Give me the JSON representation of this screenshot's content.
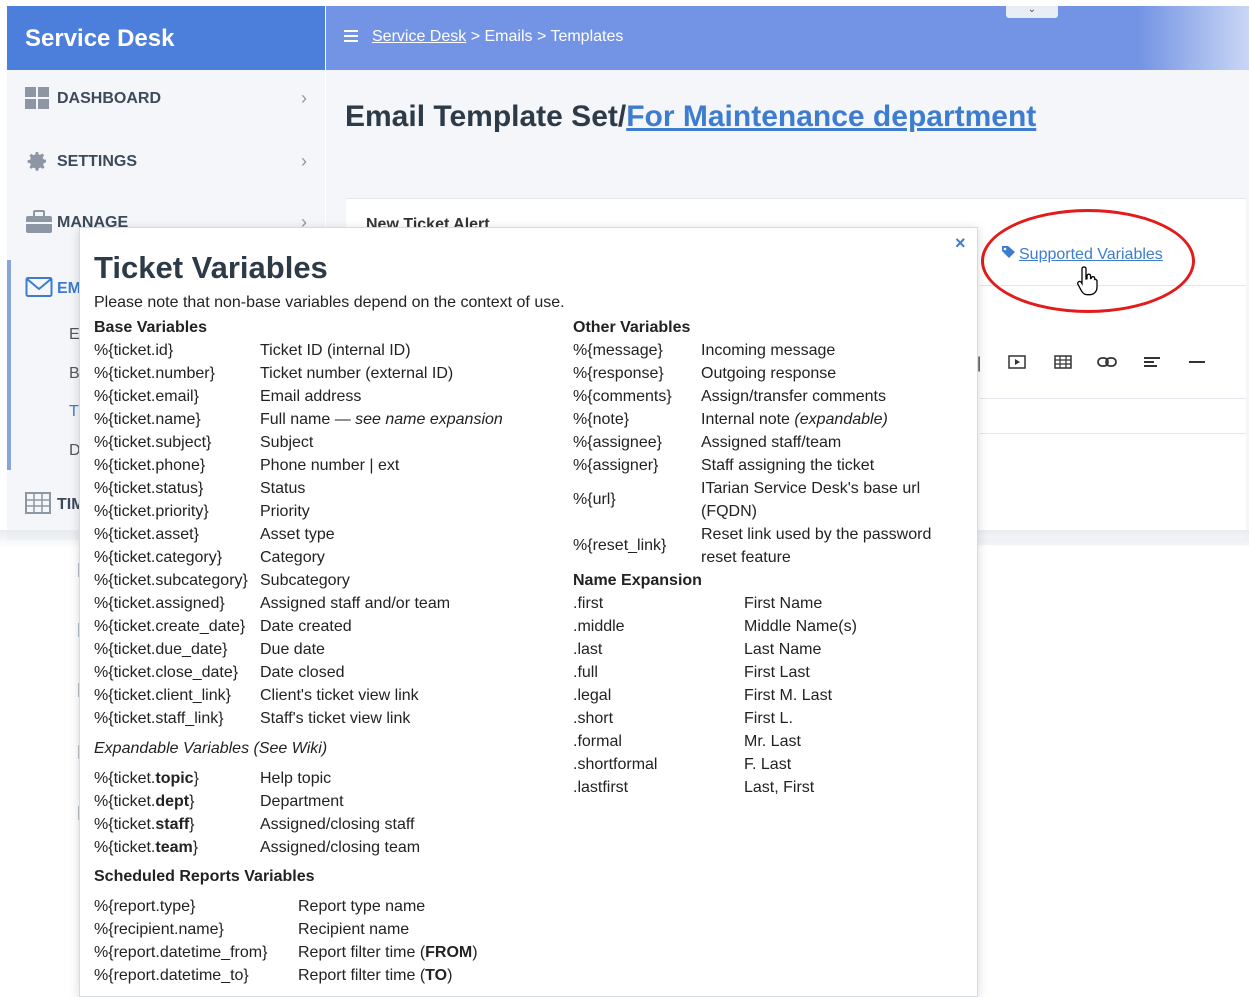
{
  "app": {
    "title": "Service Desk"
  },
  "header": {
    "breadcrumb": {
      "root": "Service Desk",
      "sep1": " > ",
      "level2": "Emails",
      "sep2": " > ",
      "level3": "Templates"
    }
  },
  "sidebar": {
    "items": [
      {
        "label": "DASHBOARD",
        "icon": "dashboard-icon"
      },
      {
        "label": "SETTINGS",
        "icon": "gear-icon"
      },
      {
        "label": "MANAGE",
        "icon": "briefcase-icon"
      },
      {
        "label": "EM",
        "icon": "envelope-icon"
      },
      {
        "label": "TIM",
        "icon": "table-icon"
      }
    ],
    "sub_letters": [
      "E",
      "B",
      "T",
      "D"
    ]
  },
  "main": {
    "title_prefix": "Email Template Set/",
    "title_link": "For Maintenance department",
    "card_title": "New Ticket Alert",
    "supported_variables": "Supported Variables",
    "toolbar_icons": [
      "divider-icon",
      "video-icon",
      "table-icon",
      "link-icon",
      "align-left-icon",
      "horizontal-rule-icon"
    ]
  },
  "popup": {
    "close_glyph": "×",
    "title": "Ticket Variables",
    "note": "Please note that non-base variables depend on the context of use.",
    "base": {
      "heading": "Base Variables",
      "rows": [
        {
          "name": "%{ticket.id}",
          "desc": "Ticket ID (internal ID)"
        },
        {
          "name": "%{ticket.number}",
          "desc": "Ticket number (external ID)"
        },
        {
          "name": "%{ticket.email}",
          "desc": "Email address"
        },
        {
          "name": "%{ticket.name}",
          "desc": "Full name — ",
          "desc_em": "see name expansion"
        },
        {
          "name": "%{ticket.subject}",
          "desc": "Subject"
        },
        {
          "name": "%{ticket.phone}",
          "desc": "Phone number | ext"
        },
        {
          "name": "%{ticket.status}",
          "desc": "Status"
        },
        {
          "name": "%{ticket.priority}",
          "desc": "Priority"
        },
        {
          "name": "%{ticket.asset}",
          "desc": "Asset type"
        },
        {
          "name": "%{ticket.category}",
          "desc": "Category"
        },
        {
          "name": "%{ticket.subcategory}",
          "desc": "Subcategory"
        },
        {
          "name": "%{ticket.assigned}",
          "desc": "Assigned staff and/or team"
        },
        {
          "name": "%{ticket.create_date}",
          "desc": "Date created"
        },
        {
          "name": "%{ticket.due_date}",
          "desc": "Due date"
        },
        {
          "name": "%{ticket.close_date}",
          "desc": "Date closed"
        },
        {
          "name": "%{ticket.client_link}",
          "desc": "Client's ticket view link"
        },
        {
          "name": "%{ticket.staff_link}",
          "desc": "Staff's ticket view link"
        }
      ]
    },
    "expandable": {
      "heading": "Expandable Variables (See Wiki)",
      "rows": [
        {
          "prefix": "%{ticket.",
          "bold": "topic",
          "suffix": "}",
          "desc": "Help topic"
        },
        {
          "prefix": "%{ticket.",
          "bold": "dept",
          "suffix": "}",
          "desc": "Department"
        },
        {
          "prefix": "%{ticket.",
          "bold": "staff",
          "suffix": "}",
          "desc": "Assigned/closing staff"
        },
        {
          "prefix": "%{ticket.",
          "bold": "team",
          "suffix": "}",
          "desc": "Assigned/closing team"
        }
      ]
    },
    "reports": {
      "heading": "Scheduled Reports Variables",
      "rows": [
        {
          "name": "%{report.type}",
          "desc": "Report type name"
        },
        {
          "name": "%{recipient.name}",
          "desc": "Recipient name"
        },
        {
          "name": "%{report.datetime_from}",
          "desc": "Report filter time (",
          "desc_bold": "FROM",
          "desc_end": ")"
        },
        {
          "name": "%{report.datetime_to}",
          "desc": "Report filter time (",
          "desc_bold": "TO",
          "desc_end": ")"
        }
      ]
    },
    "other": {
      "heading": "Other Variables",
      "rows": [
        {
          "name": "%{message}",
          "desc": "Incoming message"
        },
        {
          "name": "%{response}",
          "desc": "Outgoing response"
        },
        {
          "name": "%{comments}",
          "desc": "Assign/transfer comments"
        },
        {
          "name": "%{note}",
          "desc": "Internal note ",
          "desc_em": "(expandable)"
        },
        {
          "name": "%{assignee}",
          "desc": "Assigned staff/team"
        },
        {
          "name": "%{assigner}",
          "desc": "Staff assigning the ticket"
        },
        {
          "name": "%{url}",
          "desc": "ITarian Service Desk's base url (FQDN)"
        },
        {
          "name": "%{reset_link}",
          "desc": "Reset link used by the password reset feature"
        }
      ]
    },
    "name_expansion": {
      "heading": "Name Expansion",
      "rows": [
        {
          "name": ".first",
          "desc": "First Name"
        },
        {
          "name": ".middle",
          "desc": "Middle Name(s)"
        },
        {
          "name": ".last",
          "desc": "Last Name"
        },
        {
          "name": ".full",
          "desc": "First Last"
        },
        {
          "name": ".legal",
          "desc": "First M. Last"
        },
        {
          "name": ".short",
          "desc": "First L."
        },
        {
          "name": ".formal",
          "desc": "Mr. Last"
        },
        {
          "name": ".shortformal",
          "desc": "F. Last"
        },
        {
          "name": ".lastfirst",
          "desc": "Last, First"
        }
      ]
    }
  }
}
